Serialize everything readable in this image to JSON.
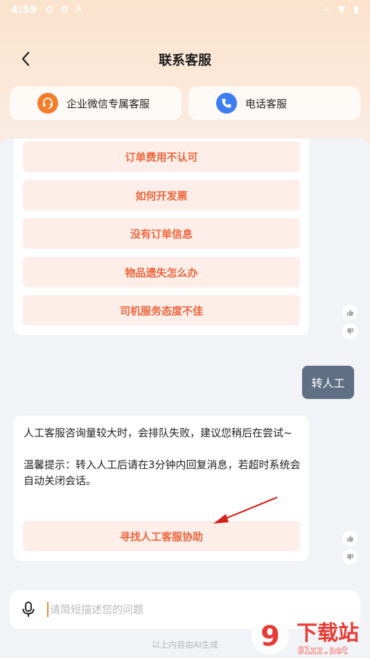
{
  "status_bar": {
    "time": "4:59",
    "icon_a": "A"
  },
  "nav": {
    "title": "联系客服"
  },
  "services": [
    {
      "label": "企业微信专属客服",
      "icon": "headset-icon",
      "color": "#f57d2a"
    },
    {
      "label": "电话客服",
      "icon": "phone-icon",
      "color": "#3e7cf2"
    }
  ],
  "questions": [
    {
      "label": "订单费用不认可"
    },
    {
      "label": "如何开发票"
    },
    {
      "label": "没有订单信息"
    },
    {
      "label": "物品遗失怎么办"
    },
    {
      "label": "司机服务态度不佳"
    }
  ],
  "user_message": "转人工",
  "bot_reply": {
    "line1": "人工客服咨询量较大时，会排队失败，建议您稍后在尝试~",
    "line2": "温馨提示：转入人工后请在3分钟内回复消息，若超时系统会自动关闭会话。",
    "button": "寻找人工客服协助"
  },
  "input": {
    "placeholder": "请简短描述您的问题"
  },
  "footer_note": "以上内容由AI生成",
  "watermark": {
    "big": "下载站",
    "url": "91xz.net",
    "logo": "9"
  },
  "colors": {
    "accent": "#f0653b",
    "question_bg": "#fdeeea",
    "user_bubble": "#5f6f84",
    "header_gradient": "#fbe3cd"
  }
}
